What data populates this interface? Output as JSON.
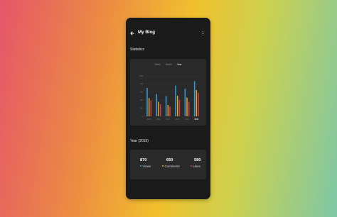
{
  "app": {
    "title": "My Blog"
  },
  "stats": {
    "section_title": "Statistics",
    "tabs": [
      {
        "label": "Week",
        "active": false
      },
      {
        "label": "Month",
        "active": false
      },
      {
        "label": "Year",
        "active": true
      }
    ]
  },
  "chart_data": {
    "type": "bar",
    "title": "",
    "categories": [
      "2010",
      "2011",
      "2012",
      "2013",
      "2014",
      "2015"
    ],
    "selected_category": "2015",
    "ylim": [
      0,
      1000
    ],
    "y_ticks": [
      "0",
      "200",
      "400",
      "600",
      "800",
      "1000"
    ],
    "grid": true,
    "series": [
      {
        "key": "views",
        "color": "#2f9fe0",
        "values": [
          700,
          550,
          500,
          760,
          680,
          870
        ]
      },
      {
        "key": "comments",
        "color": "#f0a623",
        "values": [
          450,
          360,
          280,
          510,
          460,
          650
        ]
      },
      {
        "key": "likes",
        "color": "#d8393f",
        "values": [
          390,
          300,
          240,
          400,
          360,
          580
        ]
      }
    ]
  },
  "year_summary": {
    "section_title": "Year (2015)",
    "metrics": [
      {
        "value": "870",
        "label": "Views",
        "color": "#2f9fe0"
      },
      {
        "value": "650",
        "label": "Comments",
        "color": "#f0a623"
      },
      {
        "value": "580",
        "label": "Likes",
        "color": "#d8393f"
      }
    ]
  }
}
